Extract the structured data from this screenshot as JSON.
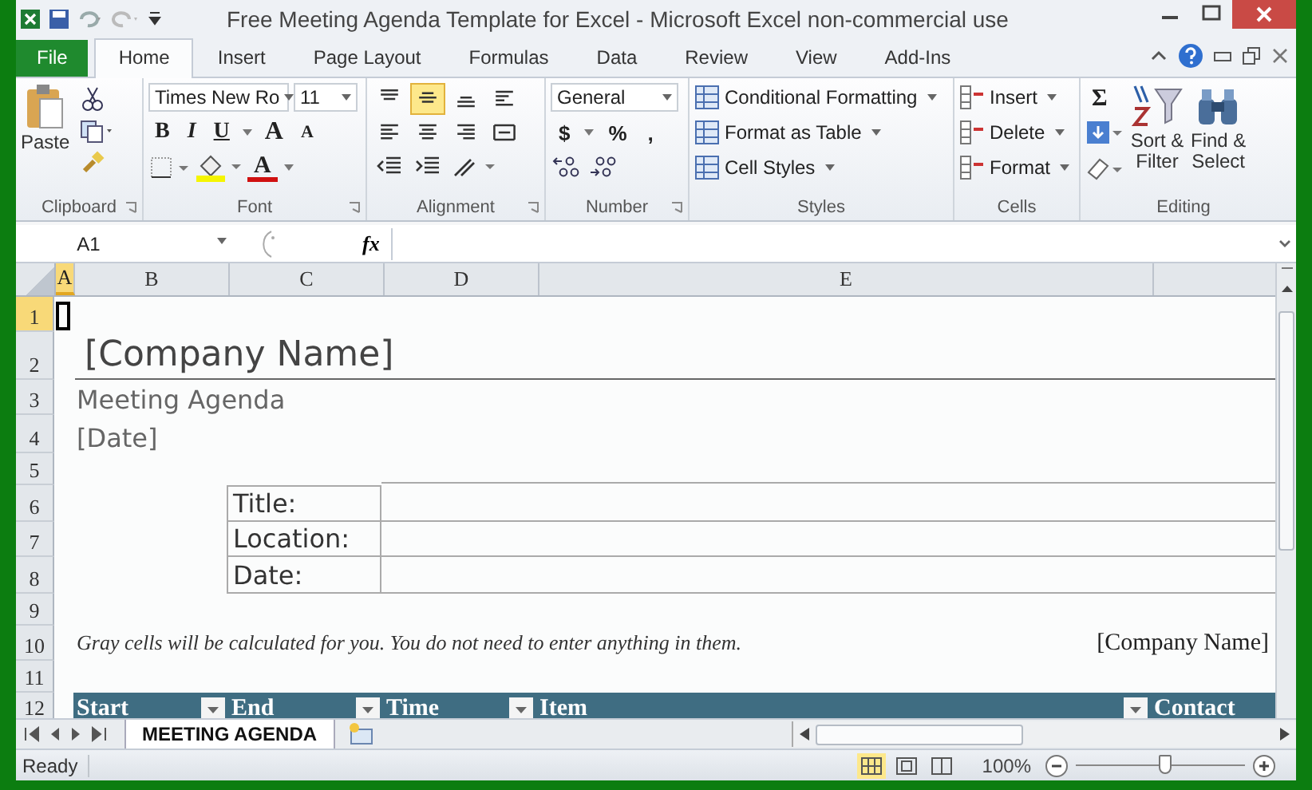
{
  "window": {
    "title": "Free Meeting Agenda Template for Excel  -  Microsoft Excel non-commercial use"
  },
  "ribbon_tabs": [
    {
      "label": "File",
      "kind": "file",
      "selected": false
    },
    {
      "label": "Home",
      "kind": "tab",
      "selected": true
    },
    {
      "label": "Insert",
      "kind": "tab",
      "selected": false
    },
    {
      "label": "Page Layout",
      "kind": "tab",
      "selected": false
    },
    {
      "label": "Formulas",
      "kind": "tab",
      "selected": false
    },
    {
      "label": "Data",
      "kind": "tab",
      "selected": false
    },
    {
      "label": "Review",
      "kind": "tab",
      "selected": false
    },
    {
      "label": "View",
      "kind": "tab",
      "selected": false
    },
    {
      "label": "Add-Ins",
      "kind": "tab",
      "selected": false
    }
  ],
  "clipboard": {
    "paste": "Paste",
    "group": "Clipboard"
  },
  "font": {
    "name": "Times New Ro",
    "size": "11",
    "bold": "B",
    "italic": "I",
    "underline": "U",
    "grow": "A",
    "shrink": "A",
    "color_button": "A",
    "group": "Font"
  },
  "alignment": {
    "buttons": [
      {
        "kind": "top",
        "selected": false
      },
      {
        "kind": "middle",
        "selected": true
      },
      {
        "kind": "bottom",
        "selected": false
      },
      {
        "kind": "wrap",
        "selected": false
      },
      {
        "kind": "left",
        "selected": false
      },
      {
        "kind": "center",
        "selected": false
      },
      {
        "kind": "right",
        "selected": false
      },
      {
        "kind": "merge",
        "selected": false
      }
    ],
    "group": "Alignment"
  },
  "number": {
    "format": "General",
    "currency": "$",
    "percent": "%",
    "comma": ",",
    "group": "Number"
  },
  "styles": {
    "items": [
      "Conditional Formatting",
      "Format as Table",
      "Cell Styles"
    ],
    "group": "Styles"
  },
  "cells": {
    "items": [
      "Insert",
      "Delete",
      "Format"
    ],
    "group": "Cells"
  },
  "editing": {
    "sum": "Σ",
    "sort": [
      "Sort &",
      "Filter"
    ],
    "find": [
      "Find &",
      "Select"
    ],
    "group": "Editing"
  },
  "formula_bar": {
    "cell_ref": "A1",
    "fx": "fx"
  },
  "columns": [
    {
      "label": "A",
      "selected": true
    },
    {
      "label": "B",
      "selected": false
    },
    {
      "label": "C",
      "selected": false
    },
    {
      "label": "D",
      "selected": false
    },
    {
      "label": "E",
      "selected": false
    }
  ],
  "rows": [
    {
      "label": "1",
      "selected": true
    },
    {
      "label": "2",
      "selected": false
    },
    {
      "label": "3",
      "selected": false
    },
    {
      "label": "4",
      "selected": false
    },
    {
      "label": "5",
      "selected": false
    },
    {
      "label": "6",
      "selected": false
    },
    {
      "label": "7",
      "selected": false
    },
    {
      "label": "8",
      "selected": false
    },
    {
      "label": "9",
      "selected": false
    },
    {
      "label": "10",
      "selected": false
    },
    {
      "label": "11",
      "selected": false
    },
    {
      "label": "12",
      "selected": false
    }
  ],
  "sheet": {
    "company": "[Company Name]",
    "subtitle": "Meeting Agenda",
    "date": "[Date]",
    "fields": [
      "Title:",
      "Location:",
      "Date:"
    ],
    "note": "Gray cells will be calculated for you. You do not need to enter anything in them.",
    "footer_company": "[Company Name]",
    "table_headers": [
      "Start",
      "End",
      "Time",
      "Item",
      "Contact"
    ]
  },
  "sheet_tabs": [
    {
      "label": "MEETING AGENDA",
      "selected": true
    }
  ],
  "status_bar": {
    "text": "Ready",
    "zoom": "100%",
    "zoom_slider": {
      "level": 0.53
    }
  }
}
